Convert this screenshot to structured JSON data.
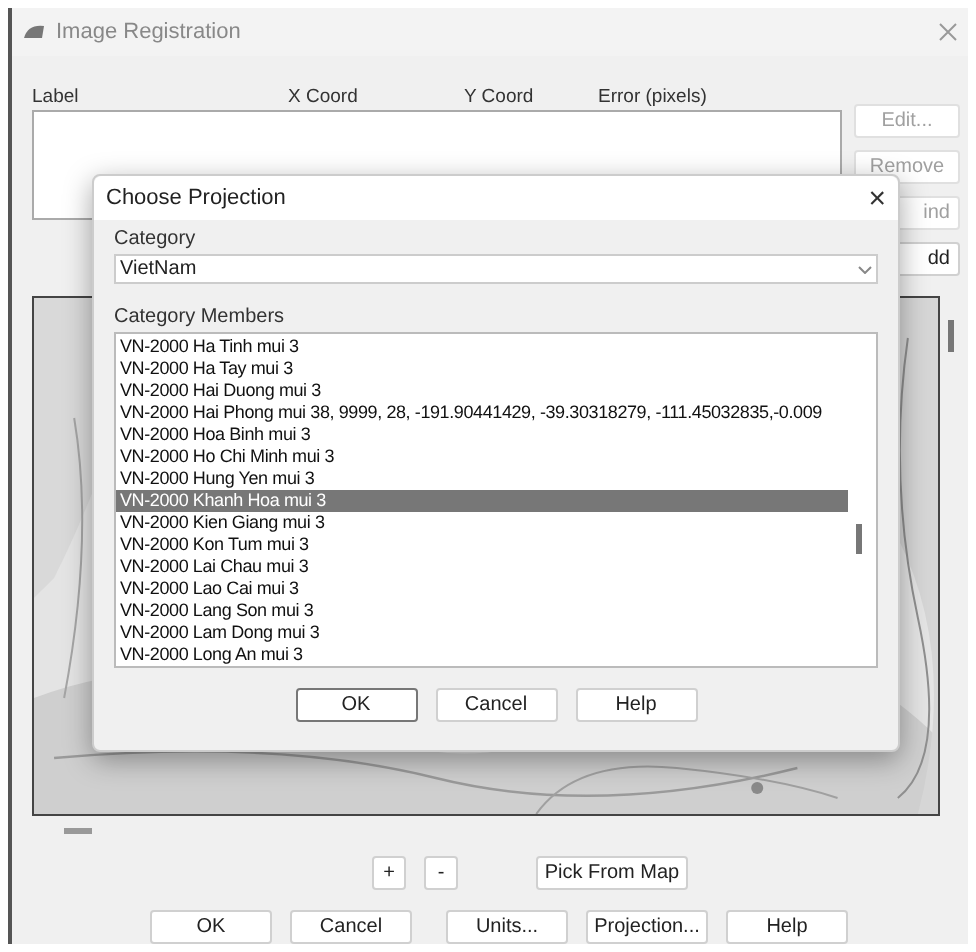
{
  "window": {
    "title": "Image Registration"
  },
  "table": {
    "columns": [
      "Label",
      "X Coord",
      "Y Coord",
      "Error (pixels)"
    ]
  },
  "side_buttons": [
    {
      "label": "Edit...",
      "disabled": true
    },
    {
      "label": "Remove",
      "disabled": true
    },
    {
      "label": "ind",
      "disabled": true
    },
    {
      "label": "dd",
      "disabled": false
    }
  ],
  "zoom_buttons": [
    "+",
    "-"
  ],
  "pick_button": "Pick From Map",
  "buttons": [
    "OK",
    "Cancel",
    "Units...",
    "Projection...",
    "Help"
  ],
  "dialog": {
    "title": "Choose Projection",
    "close": "×",
    "category_label": "Category",
    "category": "VietNam",
    "members_label": "Category Members",
    "members": [
      {
        "label": "VN-2000 Ha Tinh mui 3",
        "selected": false
      },
      {
        "label": "VN-2000 Ha Tay mui 3",
        "selected": false
      },
      {
        "label": "VN-2000 Hai Duong mui 3",
        "selected": false
      },
      {
        "label": "VN-2000 Hai Phong mui 38, 9999, 28, -191.90441429, -39.30318279, -111.45032835,-0.009",
        "selected": false
      },
      {
        "label": "VN-2000 Hoa Binh mui 3",
        "selected": false
      },
      {
        "label": "VN-2000 Ho Chi Minh mui 3",
        "selected": false
      },
      {
        "label": "VN-2000 Hung Yen mui 3",
        "selected": false
      },
      {
        "label": "VN-2000 Khanh Hoa mui 3",
        "selected": true
      },
      {
        "label": "VN-2000 Kien Giang mui 3",
        "selected": false
      },
      {
        "label": "VN-2000 Kon Tum mui 3",
        "selected": false
      },
      {
        "label": "VN-2000 Lai Chau mui 3",
        "selected": false
      },
      {
        "label": "VN-2000 Lao Cai mui 3",
        "selected": false
      },
      {
        "label": "VN-2000 Lang Son mui 3",
        "selected": false
      },
      {
        "label": "VN-2000 Lam Dong mui 3",
        "selected": false
      },
      {
        "label": "VN-2000 Long An mui 3",
        "selected": false
      }
    ],
    "buttons": [
      {
        "label": "OK",
        "default": true
      },
      {
        "label": "Cancel",
        "default": false
      },
      {
        "label": "Help",
        "default": false
      }
    ]
  }
}
